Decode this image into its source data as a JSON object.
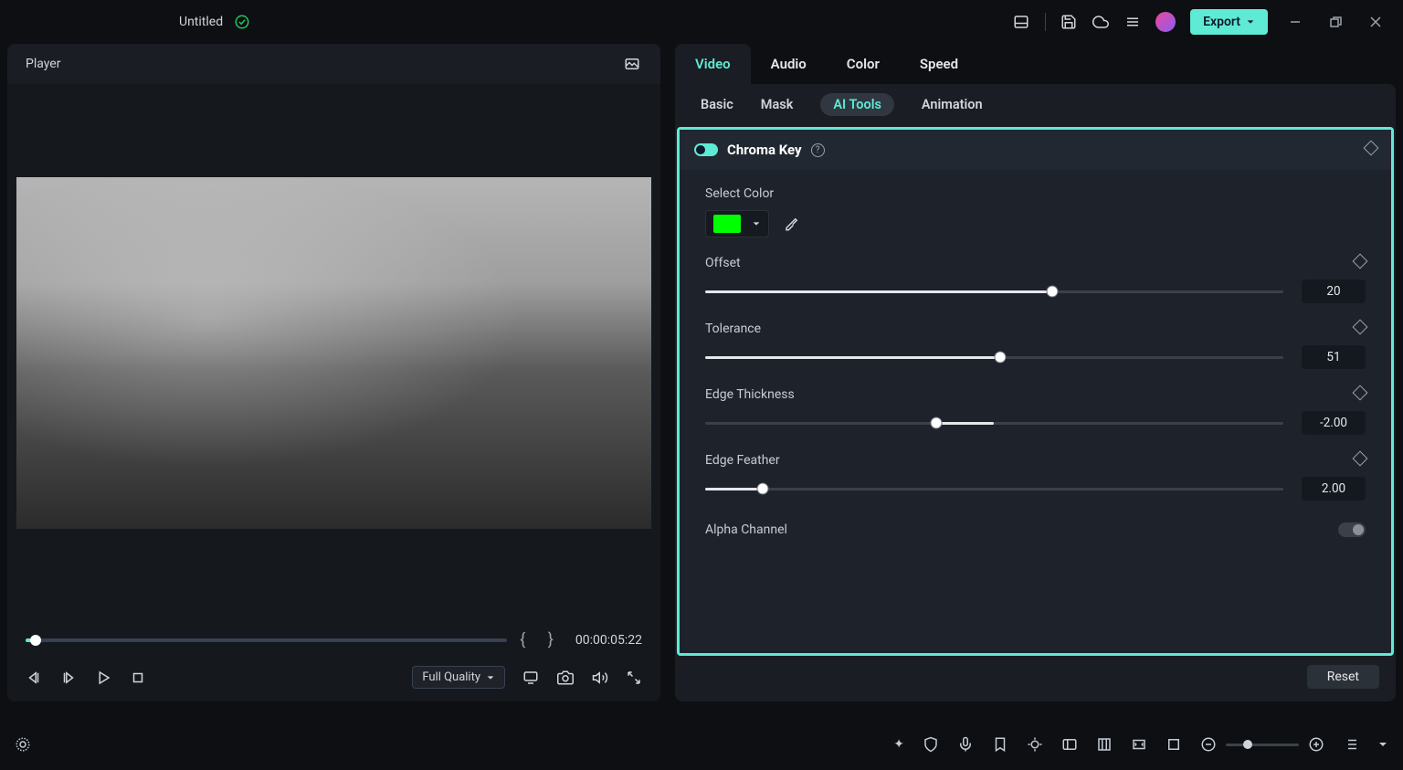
{
  "header": {
    "title": "Untitled",
    "export_label": "Export"
  },
  "player": {
    "title": "Player",
    "timecode": "00:00:05:22",
    "quality": "Full Quality",
    "scrub_percent": 2
  },
  "tabs": {
    "top": [
      {
        "label": "Video",
        "active": true
      },
      {
        "label": "Audio",
        "active": false
      },
      {
        "label": "Color",
        "active": false
      },
      {
        "label": "Speed",
        "active": false
      }
    ],
    "sub": [
      {
        "label": "Basic",
        "active": false
      },
      {
        "label": "Mask",
        "active": false
      },
      {
        "label": "AI Tools",
        "active": true
      },
      {
        "label": "Animation",
        "active": false
      }
    ]
  },
  "chroma": {
    "title": "Chroma Key",
    "select_color_label": "Select Color",
    "selected_color": "#00ff00",
    "sliders": [
      {
        "label": "Offset",
        "value": "20",
        "fill_pct": 60,
        "thumb_pct": 60
      },
      {
        "label": "Tolerance",
        "value": "51",
        "fill_pct": 51,
        "thumb_pct": 51
      },
      {
        "label": "Edge Thickness",
        "value": "-2.00",
        "fill_pct_start": 40,
        "fill_pct_end": 50,
        "thumb_pct": 40
      },
      {
        "label": "Edge Feather",
        "value": "2.00",
        "fill_pct": 10,
        "thumb_pct": 10
      }
    ],
    "alpha_label": "Alpha Channel"
  },
  "reset_label": "Reset"
}
